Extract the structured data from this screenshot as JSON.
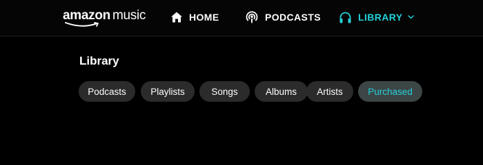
{
  "brand": {
    "logo_text_brand": "amazon",
    "logo_text_product": "music"
  },
  "nav": {
    "items": [
      {
        "label": "HOME",
        "icon": "home-icon"
      },
      {
        "label": "PODCASTS",
        "icon": "podcast-icon"
      },
      {
        "label": "LIBRARY",
        "icon": "headphones-icon",
        "active": true,
        "has_dropdown": true
      }
    ]
  },
  "page": {
    "title": "Library"
  },
  "filters": {
    "chips": [
      {
        "label": "Podcasts"
      },
      {
        "label": "Playlists"
      },
      {
        "label": "Songs"
      },
      {
        "label": "Albums"
      },
      {
        "label": "Artists"
      },
      {
        "label": "Purchased",
        "active": true
      }
    ]
  },
  "colors": {
    "accent": "#25d1da",
    "background": "#000000",
    "chip_bg": "#2b2b2b",
    "chip_active_bg": "#3d4646"
  }
}
